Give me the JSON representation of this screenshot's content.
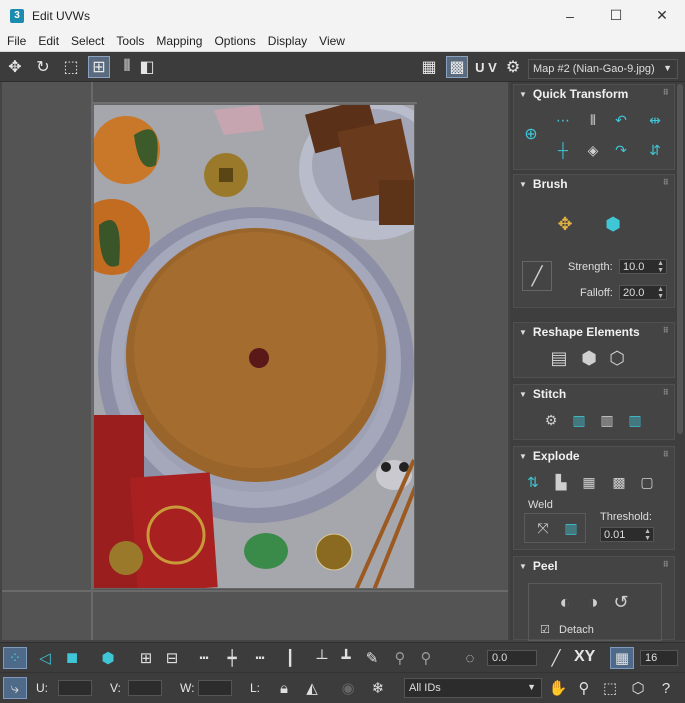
{
  "window": {
    "title": "Edit UVWs",
    "app_badge": "3",
    "minimize": "–",
    "maximize": "☐",
    "close": "✕"
  },
  "menu": [
    "File",
    "Edit",
    "Select",
    "Tools",
    "Mapping",
    "Options",
    "Display",
    "View"
  ],
  "toolbar": {
    "uv_label": "U V",
    "map_selector": "Map #2 (Nian-Gao-9.jpg)"
  },
  "panel": {
    "quick_transform": {
      "title": "Quick Transform"
    },
    "brush": {
      "title": "Brush",
      "strength_label": "Strength:",
      "strength_value": "10.0",
      "falloff_label": "Falloff:",
      "falloff_value": "20.0"
    },
    "reshape": {
      "title": "Reshape Elements"
    },
    "stitch": {
      "title": "Stitch"
    },
    "explode": {
      "title": "Explode",
      "weld_label": "Weld",
      "threshold_label": "Threshold:",
      "threshold_value": "0.01"
    },
    "peel": {
      "title": "Peel",
      "detach_label": "Detach"
    }
  },
  "bottom": {
    "rotate_value": "0.0",
    "xy_label": "XY",
    "grid_value": "16",
    "u_label": "U:",
    "v_label": "V:",
    "w_label": "W:",
    "l_label": "L:",
    "ids_select": "All IDs"
  },
  "colors": {
    "accent": "#3fc7d8",
    "bg": "#444444",
    "panel": "#3e3e3e"
  },
  "icons": [
    "move-icon",
    "rotate-icon",
    "scale-icon",
    "freeform-icon",
    "mirror-icon",
    "checker-icon",
    "snap-icon",
    "brush-icon"
  ]
}
